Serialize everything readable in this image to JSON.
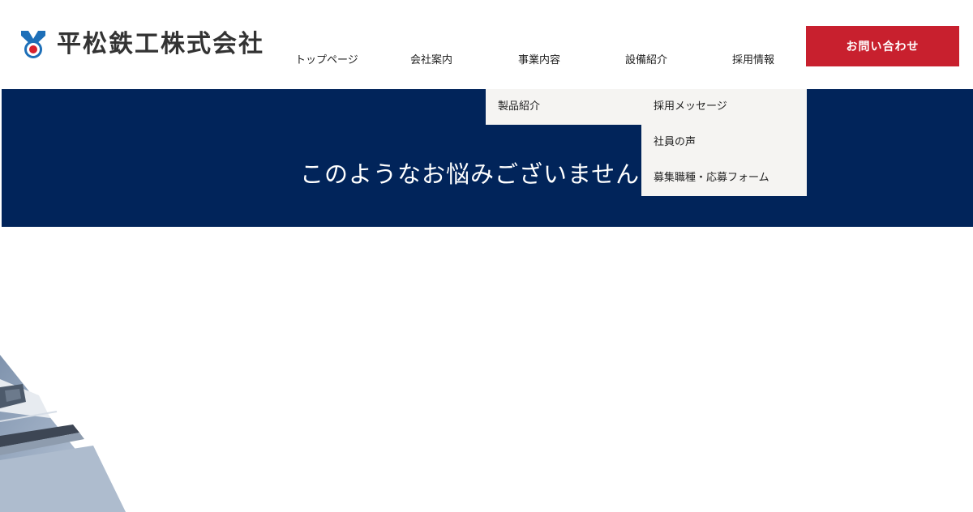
{
  "brand": {
    "name": "平松鉄工株式会社",
    "logo_icon": "company-emblem-icon",
    "colors": {
      "accent": "#c8202e",
      "navy": "#01245a",
      "logo_blue": "#1d6fb8"
    }
  },
  "nav": {
    "items": [
      {
        "label": "トップページ"
      },
      {
        "label": "会社案内"
      },
      {
        "label": "事業内容"
      },
      {
        "label": "設備紹介"
      },
      {
        "label": "採用情報"
      }
    ],
    "contact_label": "お問い合わせ"
  },
  "dropdowns": {
    "business": {
      "items": [
        "製品紹介"
      ]
    },
    "recruit": {
      "items": [
        "採用メッセージ",
        "社員の声",
        "募集職種・応募フォーム"
      ]
    }
  },
  "hero": {
    "title": "このようなお悩みございませんか？"
  }
}
